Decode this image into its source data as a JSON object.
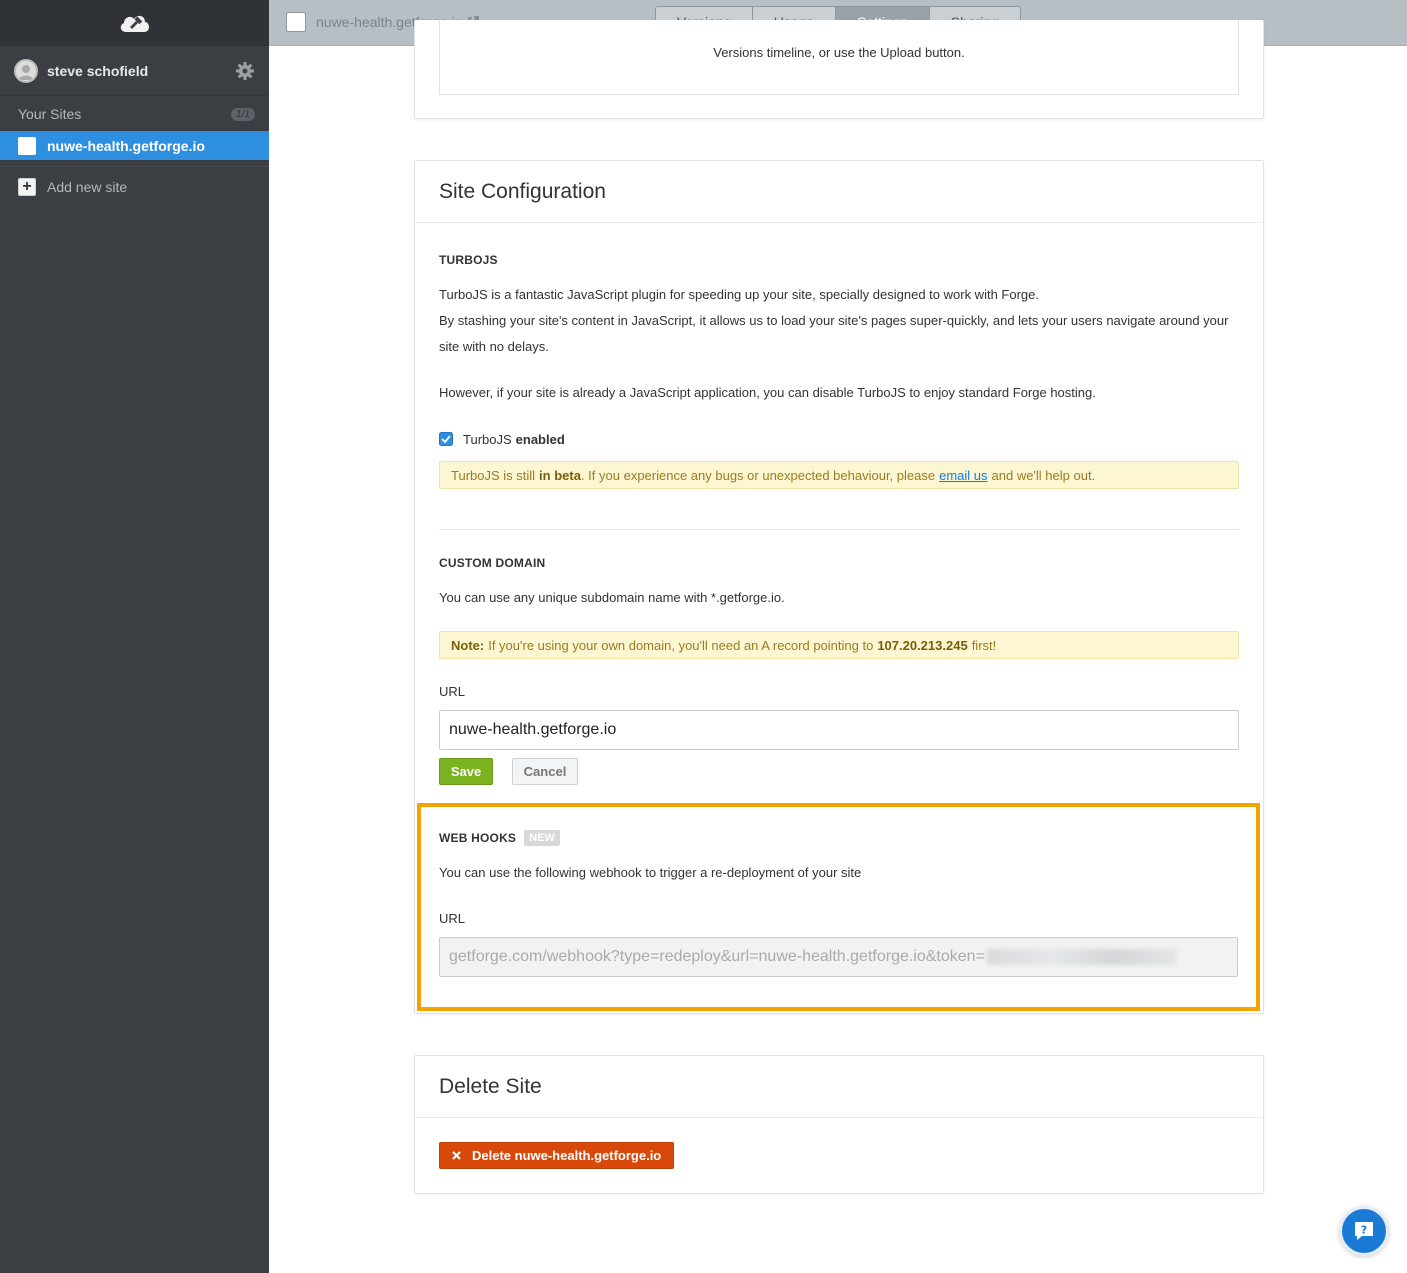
{
  "sidebar": {
    "logo_icon": "cloud-forge-icon",
    "user_name": "steve schofield",
    "sites_label": "Your Sites",
    "sites_count": "1/1",
    "site_name": "nuwe-health.getforge.io",
    "add_site_label": "Add new site"
  },
  "topbar": {
    "site_name": "nuwe-health.getforge.io",
    "tabs": [
      "Versions",
      "Usage",
      "Settings",
      "Sharing"
    ],
    "active_tab": "Settings"
  },
  "versions_card": {
    "text": "Versions timeline, or use the Upload button."
  },
  "config": {
    "title": "Site Configuration",
    "turbo": {
      "heading": "TURBOJS",
      "p1": "TurboJS is a fantastic JavaScript plugin for speeding up your site, specially designed to work with Forge.",
      "p2": "By stashing your site's content in JavaScript, it allows us to load your site's pages super-quickly, and lets your users navigate around your site with no delays.",
      "p3": "However, if your site is already a JavaScript application, you can disable TurboJS to enjoy standard Forge hosting.",
      "checkbox_label": "TurboJS",
      "checkbox_state": "enabled",
      "beta_pre": "TurboJS is still",
      "beta_bold": "in beta",
      "beta_mid": ". If you experience any bugs or unexpected behaviour, please",
      "beta_link": "email us",
      "beta_post": "and we'll help out."
    },
    "domain": {
      "heading": "CUSTOM DOMAIN",
      "desc": "You can use any unique subdomain name with *.getforge.io.",
      "note_label": "Note:",
      "note_text": "If you're using your own domain, you'll need an A record pointing to",
      "note_ip": "107.20.213.245",
      "note_end": "first!",
      "url_label": "URL",
      "url_value": "nuwe-health.getforge.io",
      "save_label": "Save",
      "cancel_label": "Cancel"
    },
    "webhooks": {
      "heading": "WEB HOOKS",
      "badge": "NEW",
      "desc": "You can use the following webhook to trigger a re-deployment of your site",
      "url_label": "URL",
      "url_value": "getforge.com/webhook?type=redeploy&url=nuwe-health.getforge.io&token=",
      "highlight_color": "#f5a300"
    }
  },
  "delete": {
    "title": "Delete Site",
    "button_label": "Delete nuwe-health.getforge.io"
  },
  "help": {
    "icon": "chat-question-icon"
  }
}
